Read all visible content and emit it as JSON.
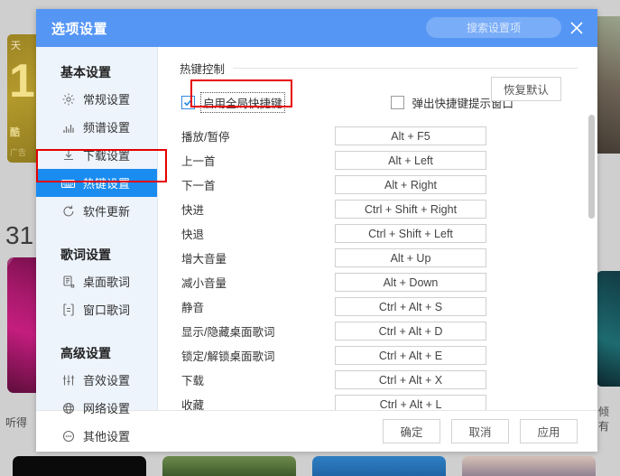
{
  "background": {
    "ad": {
      "top_text": "天",
      "big_text": "1",
      "sub_text": "酷",
      "tag": "广告"
    },
    "count_text": "31",
    "left_caption": "听得",
    "right_caption": "倾有",
    "bottom_cards": [
      "card-1",
      "card-2",
      "card-3",
      "card-4"
    ]
  },
  "dialog": {
    "title": "选项设置",
    "search": {
      "placeholder": "搜索设置项",
      "value": ""
    },
    "close_icon": "close-icon"
  },
  "sidebar": {
    "groups": [
      {
        "title": "基本设置",
        "items": [
          {
            "label": "常规设置",
            "icon": "gear-icon",
            "active": false
          },
          {
            "label": "频谱设置",
            "icon": "bar-chart-icon",
            "active": false
          },
          {
            "label": "下载设置",
            "icon": "download-icon",
            "active": false
          },
          {
            "label": "热键设置",
            "icon": "keyboard-icon",
            "active": true
          },
          {
            "label": "软件更新",
            "icon": "refresh-icon",
            "active": false
          }
        ]
      },
      {
        "title": "歌词设置",
        "items": [
          {
            "label": "桌面歌词",
            "icon": "document-icon",
            "active": false
          },
          {
            "label": "窗口歌词",
            "icon": "frame-icon",
            "active": false
          }
        ]
      },
      {
        "title": "高级设置",
        "items": [
          {
            "label": "音效设置",
            "icon": "sliders-icon",
            "active": false
          },
          {
            "label": "网络设置",
            "icon": "globe-icon",
            "active": false
          },
          {
            "label": "其他设置",
            "icon": "ellipsis-icon",
            "active": false
          }
        ]
      }
    ]
  },
  "main": {
    "section_title": "热键控制",
    "options": [
      {
        "label": "启用全局快捷键",
        "checked": true,
        "focused": true
      },
      {
        "label": "弹出快捷键提示窗口",
        "checked": false,
        "focused": false
      }
    ],
    "restore_button": "恢复默认",
    "hotkeys": [
      {
        "name": "播放/暂停",
        "value": "Alt + F5"
      },
      {
        "name": "上一首",
        "value": "Alt + Left"
      },
      {
        "name": "下一首",
        "value": "Alt + Right"
      },
      {
        "name": "快进",
        "value": "Ctrl + Shift + Right"
      },
      {
        "name": "快退",
        "value": "Ctrl + Shift + Left"
      },
      {
        "name": "增大音量",
        "value": "Alt + Up"
      },
      {
        "name": "减小音量",
        "value": "Alt + Down"
      },
      {
        "name": "静音",
        "value": "Ctrl + Alt + S"
      },
      {
        "name": "显示/隐藏桌面歌词",
        "value": "Ctrl + Alt + D"
      },
      {
        "name": "锁定/解锁桌面歌词",
        "value": "Ctrl + Alt + E"
      },
      {
        "name": "下载",
        "value": "Ctrl + Alt + X"
      },
      {
        "name": "收藏",
        "value": "Ctrl + Alt + L"
      }
    ]
  },
  "footer": {
    "buttons": [
      {
        "label": "确定"
      },
      {
        "label": "取消"
      },
      {
        "label": "应用"
      }
    ]
  },
  "colors": {
    "titlebar": "#5596f5",
    "active_nav": "#1a8cf0",
    "sidebar_bg": "#eef4fc",
    "annotation": "#e60000",
    "checkbox_check": "#2f8ae0"
  }
}
